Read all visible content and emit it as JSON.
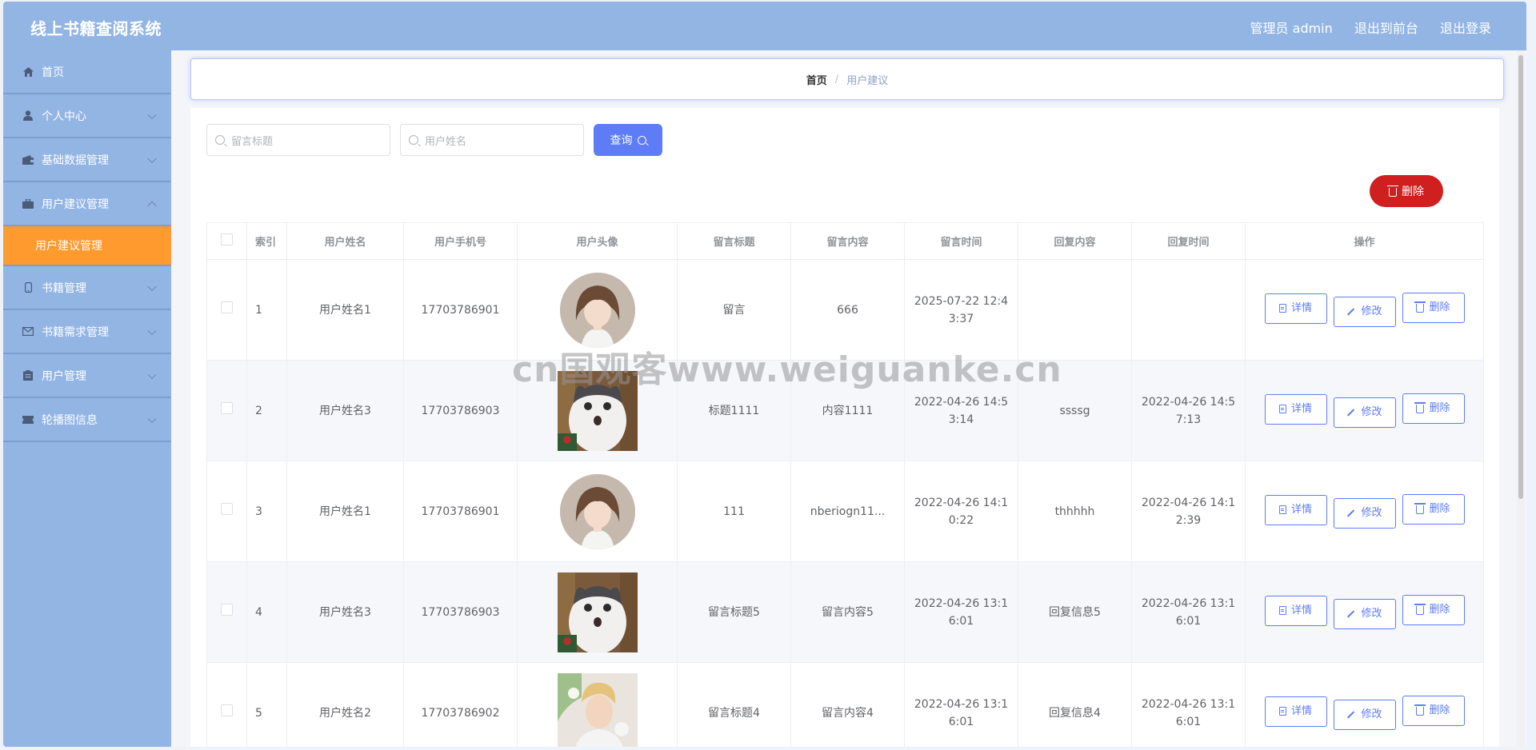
{
  "header": {
    "app_title": "线上书籍查阅系统",
    "user_label": "管理员 admin",
    "exit_front_label": "退出到前台",
    "logout_label": "退出登录"
  },
  "sidebar": {
    "items": [
      {
        "label": "首页",
        "icon": "home-icon"
      },
      {
        "label": "个人中心",
        "icon": "user-icon"
      },
      {
        "label": "基础数据管理",
        "icon": "wallet-icon"
      },
      {
        "label": "用户建议管理",
        "icon": "briefcase-icon"
      },
      {
        "label": "书籍管理",
        "icon": "phone-icon"
      },
      {
        "label": "书籍需求管理",
        "icon": "mail-icon"
      },
      {
        "label": "用户管理",
        "icon": "clipboard-icon"
      },
      {
        "label": "轮播图信息",
        "icon": "ticket-icon"
      }
    ],
    "active_submenu": "用户建议管理",
    "accent": "#ff9a2e"
  },
  "breadcrumb": {
    "home": "首页",
    "separator": "/",
    "current": "用户建议"
  },
  "search": {
    "title_placeholder": "留言标题",
    "name_placeholder": "用户姓名",
    "query_label": "查询"
  },
  "toolbar": {
    "delete_label": "删除",
    "delete_color": "#cf1f1f"
  },
  "table": {
    "headers": [
      "索引",
      "用户姓名",
      "用户手机号",
      "用户头像",
      "留言标题",
      "留言内容",
      "留言时间",
      "回复内容",
      "回复时间",
      "操作"
    ],
    "rows": [
      {
        "index": "1",
        "name": "用户姓名1",
        "phone": "17703786901",
        "avatar": "woman-portrait",
        "title": "留言",
        "content": "666",
        "time": "2025-07-22 12:43:37",
        "reply": "",
        "reply_time": ""
      },
      {
        "index": "2",
        "name": "用户姓名3",
        "phone": "17703786903",
        "avatar": "cat-photo",
        "title": "标题1111",
        "content": "内容1111",
        "time": "2022-04-26 14:53:14",
        "reply": "ssssg",
        "reply_time": "2022-04-26 14:57:13"
      },
      {
        "index": "3",
        "name": "用户姓名1",
        "phone": "17703786901",
        "avatar": "woman-portrait",
        "title": "111",
        "content": "nberiogn11...",
        "time": "2022-04-26 14:10:22",
        "reply": "thhhhh",
        "reply_time": "2022-04-26 14:12:39"
      },
      {
        "index": "4",
        "name": "用户姓名3",
        "phone": "17703786903",
        "avatar": "cat-photo",
        "title": "留言标题5",
        "content": "留言内容5",
        "time": "2022-04-26 13:16:01",
        "reply": "回复信息5",
        "reply_time": "2022-04-26 13:16:01"
      },
      {
        "index": "5",
        "name": "用户姓名2",
        "phone": "17703786902",
        "avatar": "man-photo",
        "title": "留言标题4",
        "content": "留言内容4",
        "time": "2022-04-26 13:16:01",
        "reply": "回复信息4",
        "reply_time": "2022-04-26 13:16:01"
      }
    ],
    "actions": {
      "detail": "详情",
      "edit": "修改",
      "delete": "删除"
    }
  },
  "watermark": "cn国观客www.weiguanke.cn",
  "colors": {
    "header_bg": "#92b5e4",
    "primary": "#5d7cf6"
  }
}
